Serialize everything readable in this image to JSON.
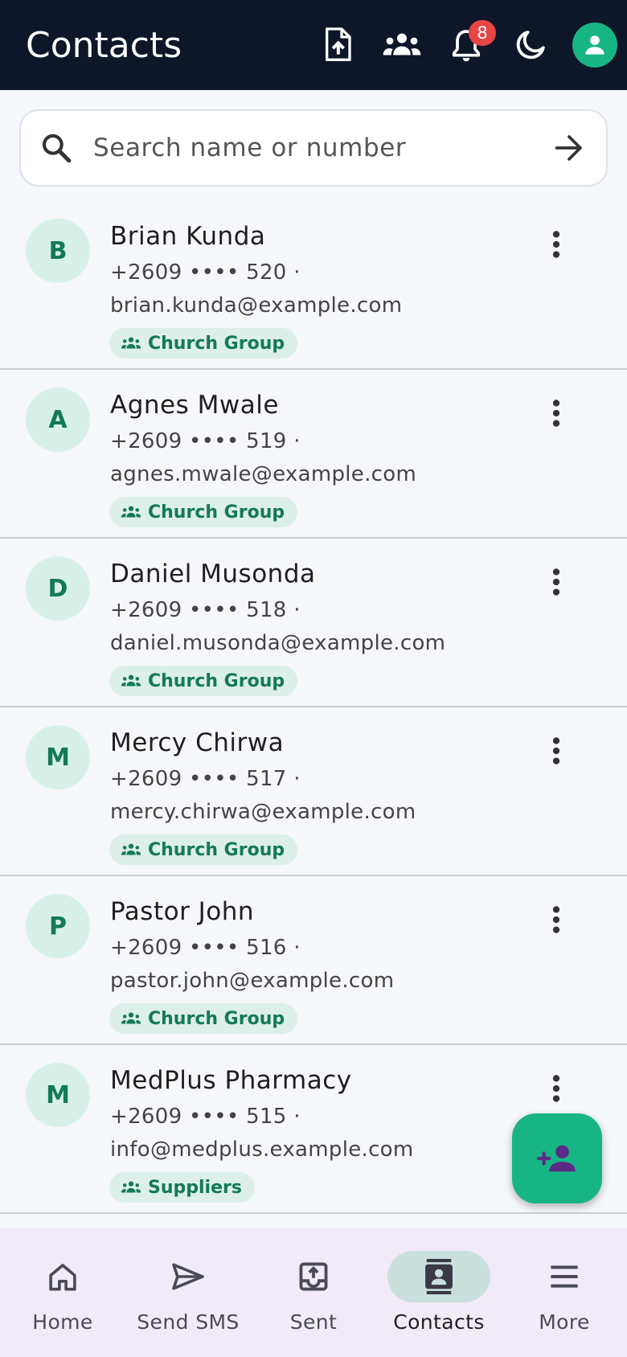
{
  "appbar": {
    "title": "Contacts",
    "notification_count": "8",
    "icons": [
      "upload-file-icon",
      "groups-icon",
      "bell-icon",
      "moon-icon",
      "profile-icon"
    ]
  },
  "search": {
    "placeholder": "Search name or number"
  },
  "contacts": [
    {
      "initial": "B",
      "name": "Brian Kunda",
      "phone": "+2609 •••• 520 ·",
      "email": "brian.kunda@example.com",
      "group": "Church Group"
    },
    {
      "initial": "A",
      "name": "Agnes Mwale",
      "phone": "+2609 •••• 519 ·",
      "email": "agnes.mwale@example.com",
      "group": "Church Group"
    },
    {
      "initial": "D",
      "name": "Daniel Musonda",
      "phone": "+2609 •••• 518 ·",
      "email": "daniel.musonda@example.com",
      "group": "Church Group"
    },
    {
      "initial": "M",
      "name": "Mercy Chirwa",
      "phone": "+2609 •••• 517 ·",
      "email": "mercy.chirwa@example.com",
      "group": "Church Group"
    },
    {
      "initial": "P",
      "name": "Pastor John",
      "phone": "+2609 •••• 516 ·",
      "email": "pastor.john@example.com",
      "group": "Church Group"
    },
    {
      "initial": "M",
      "name": "MedPlus Pharmacy",
      "phone": "+2609 •••• 515 ·",
      "email": "info@medplus.example.com",
      "group": "Suppliers"
    }
  ],
  "nav": [
    {
      "label": "Home",
      "icon": "home-icon"
    },
    {
      "label": "Send SMS",
      "icon": "send-icon"
    },
    {
      "label": "Sent",
      "icon": "outbox-icon"
    },
    {
      "label": "Contacts",
      "icon": "contacts-icon",
      "active": true
    },
    {
      "label": "More",
      "icon": "menu-icon"
    }
  ],
  "colors": {
    "appbar": "#0e1629",
    "accent": "#17b584",
    "badge": "#e84545",
    "fab_icon": "#5b2a86"
  }
}
